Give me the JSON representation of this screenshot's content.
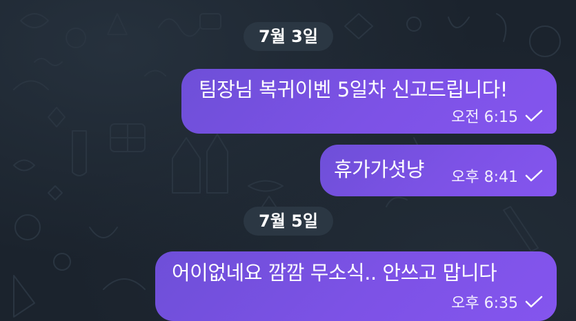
{
  "chat": {
    "dates": [
      {
        "label": "7월 3일"
      },
      {
        "label": "7월 5일"
      }
    ],
    "messages": [
      {
        "text": "팀장님 복귀이벤 5일차 신고드립니다!",
        "time": "오전 6:15",
        "status_icon": "single-check-icon"
      },
      {
        "text": "휴가가셧냥",
        "time": "오후 8:41",
        "status_icon": "single-check-icon"
      },
      {
        "text": "어이없네요 깜깜 무소식.. 안쓰고 맙니다",
        "time": "오후 6:35",
        "status_icon": "single-check-icon"
      }
    ]
  },
  "theme": {
    "background": "#1b232d",
    "bubble_gradient_start": "#6e4fd8",
    "bubble_gradient_end": "#8455ee",
    "date_pill": "#2b3743"
  }
}
